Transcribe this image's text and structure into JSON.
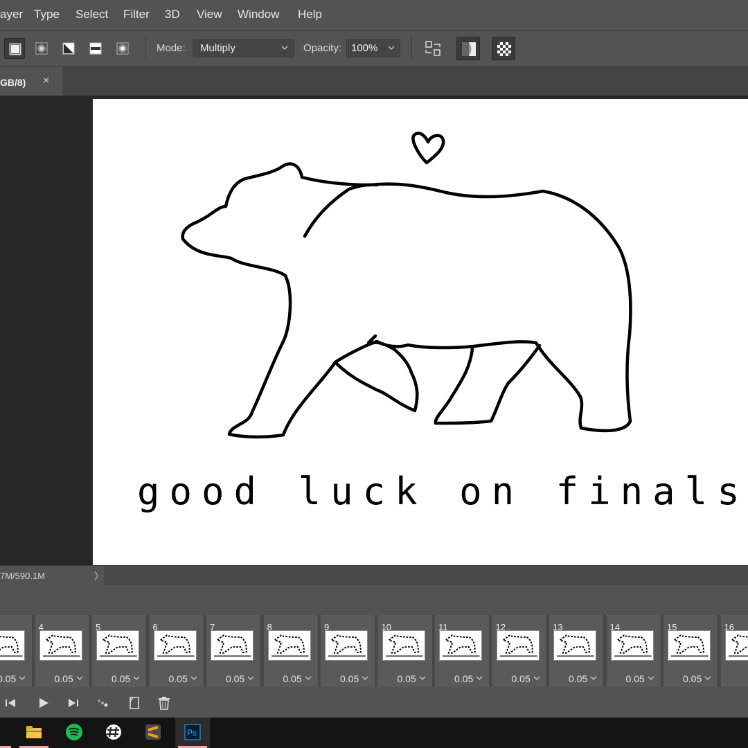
{
  "menubar": {
    "items": [
      "ayer",
      "Type",
      "Select",
      "Filter",
      "3D",
      "View",
      "Window",
      "Help"
    ]
  },
  "options": {
    "mode_label": "Mode:",
    "mode_value": "Multiply",
    "opacity_label": "Opacity:",
    "opacity_value": "100%",
    "gradient_types": [
      "linear-gradient-icon",
      "radial-gradient-icon",
      "angle-gradient-icon",
      "reflected-gradient-icon",
      "diamond-gradient-icon"
    ]
  },
  "document": {
    "tab_title": "GB/8)",
    "close_glyph": "×"
  },
  "canvas": {
    "caption": "good luck on finals!"
  },
  "status": {
    "text": "7M/590.1M",
    "arrow": "〉"
  },
  "timeline": {
    "frames": [
      {
        "num": "",
        "delay": "0.05"
      },
      {
        "num": "4",
        "delay": "0.05"
      },
      {
        "num": "5",
        "delay": "0.05"
      },
      {
        "num": "6",
        "delay": "0.05"
      },
      {
        "num": "7",
        "delay": "0.05"
      },
      {
        "num": "8",
        "delay": "0.05"
      },
      {
        "num": "9",
        "delay": "0.05"
      },
      {
        "num": "10",
        "delay": "0.05"
      },
      {
        "num": "11",
        "delay": "0.05"
      },
      {
        "num": "12",
        "delay": "0.05"
      },
      {
        "num": "13",
        "delay": "0.05"
      },
      {
        "num": "14",
        "delay": "0.05"
      },
      {
        "num": "15",
        "delay": "0.05"
      },
      {
        "num": "16",
        "delay": ""
      }
    ]
  },
  "taskbar": {
    "apps": [
      "file-explorer-icon",
      "spotify-icon",
      "slack-icon",
      "sublime-text-icon",
      "photoshop-icon"
    ],
    "photoshop_label": "Ps"
  },
  "colors": {
    "ui_bg": "#535353",
    "workspace_bg": "#282828",
    "spotify_green": "#1db954",
    "photoshop_blue": "#31a8ff",
    "sublime_orange": "#f79a1e"
  }
}
